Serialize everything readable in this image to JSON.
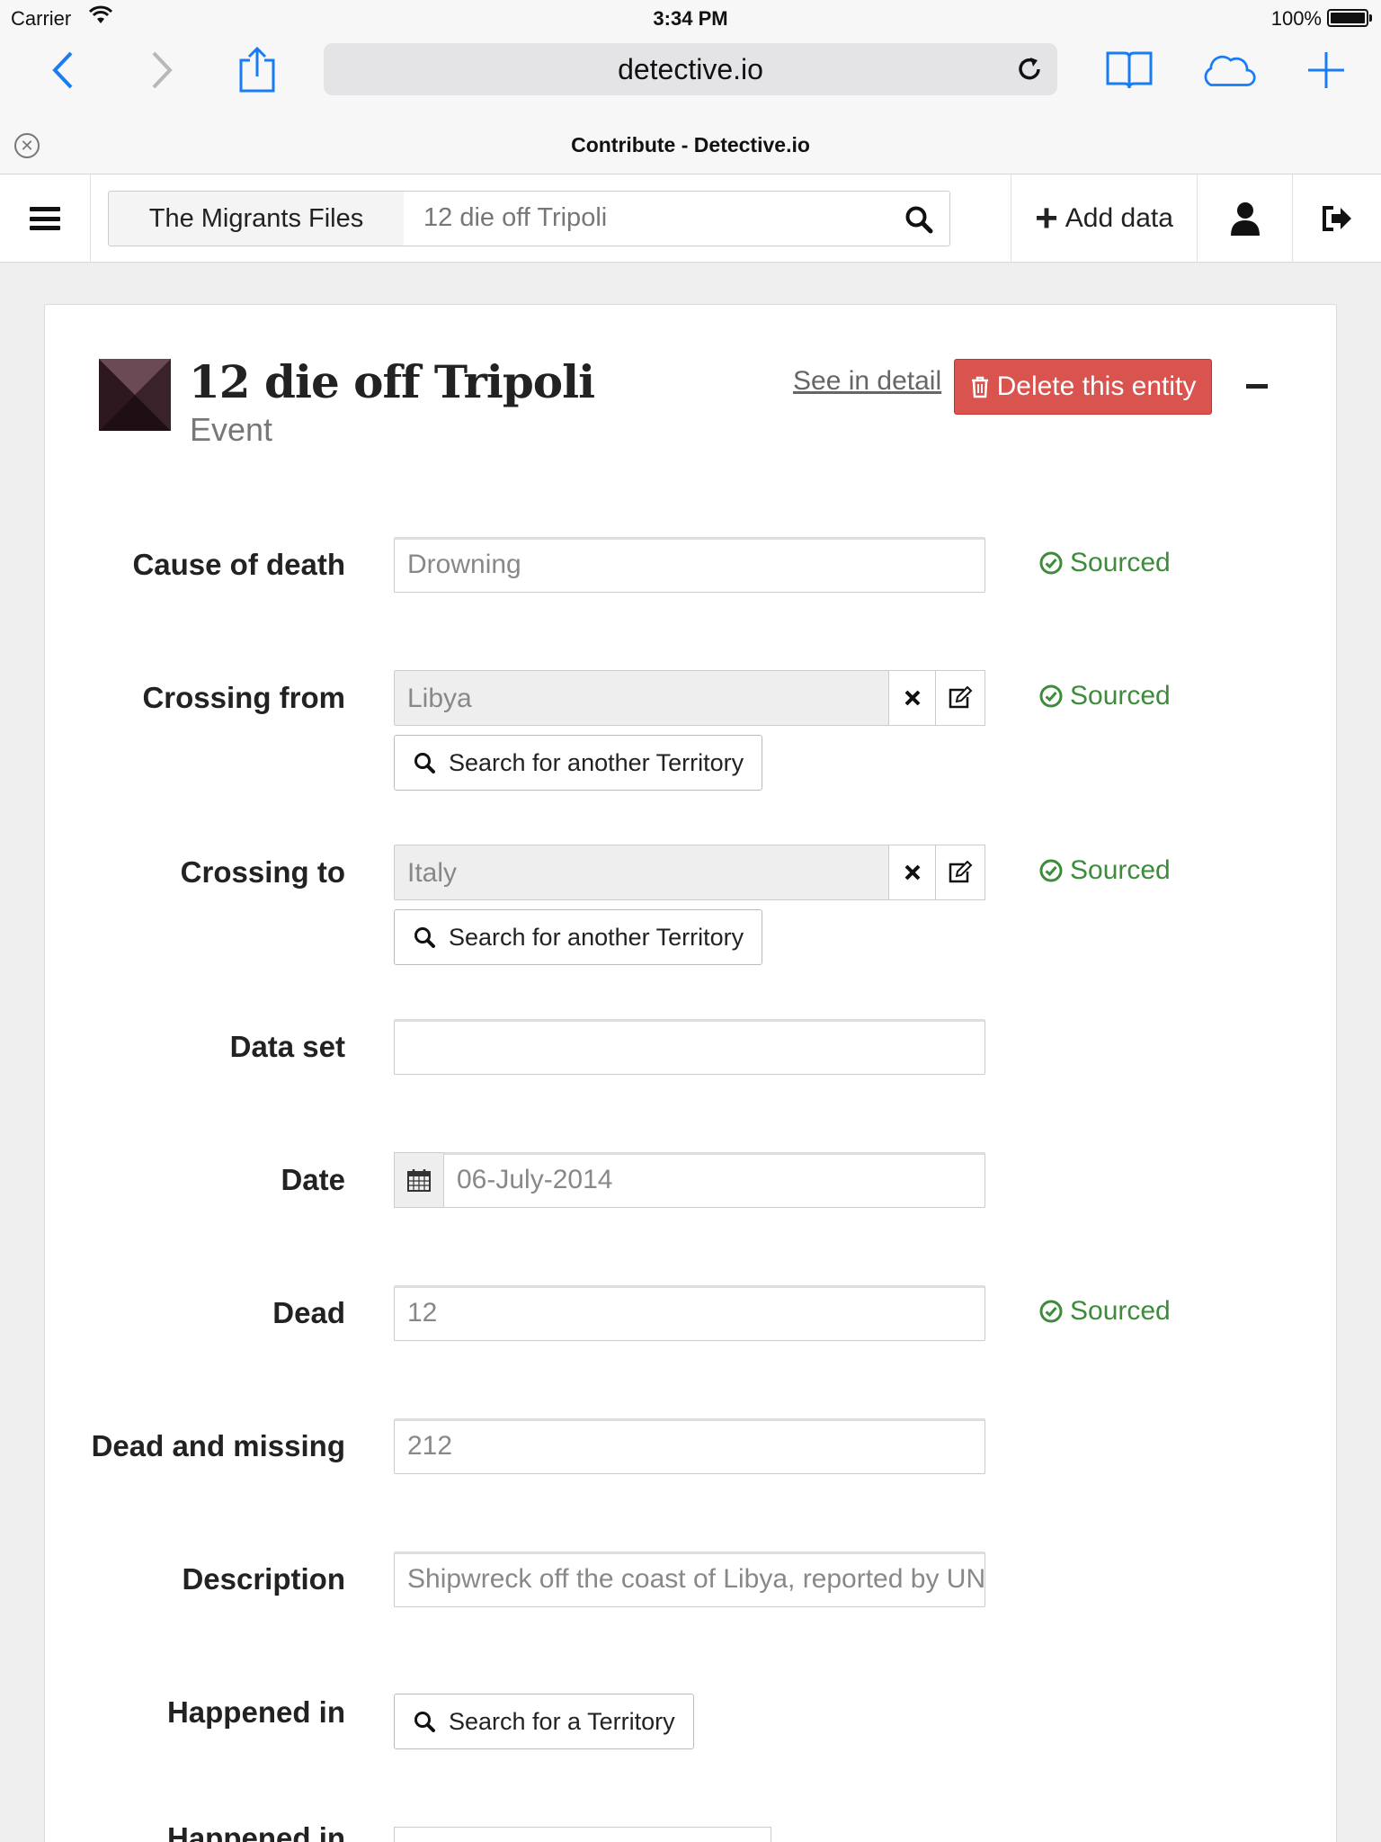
{
  "status_bar": {
    "carrier": "Carrier",
    "time": "3:34 PM",
    "battery": "100%"
  },
  "browser": {
    "url": "detective.io",
    "tab_title": "Contribute - Detective.io"
  },
  "navbar": {
    "project": "The Migrants Files",
    "search_value": "12 die off Tripoli",
    "add_label": "Add data"
  },
  "entity": {
    "title": "12 die off Tripoli",
    "type": "Event",
    "see_detail": "See in detail",
    "delete_label": "Delete this entity"
  },
  "fields": {
    "cause_of_death": {
      "label": "Cause of death",
      "value": "Drowning",
      "status": "Sourced"
    },
    "crossing_from": {
      "label": "Crossing from",
      "value": "Libya",
      "status": "Sourced",
      "search": "Search for another Territory"
    },
    "crossing_to": {
      "label": "Crossing to",
      "value": "Italy",
      "status": "Sourced",
      "search": "Search for another Territory"
    },
    "data_set": {
      "label": "Data set",
      "value": ""
    },
    "date": {
      "label": "Date",
      "value": "06-July-2014"
    },
    "dead": {
      "label": "Dead",
      "value": "12",
      "status": "Sourced"
    },
    "dead_and_missing": {
      "label": "Dead and missing",
      "value": "212"
    },
    "description": {
      "label": "Description",
      "value": "Shipwreck off the coast of Libya, reported by UNH"
    },
    "happened_in": {
      "label": "Happened in",
      "search": "Search for a Territory"
    },
    "next_partial": {
      "label": "Happened in"
    }
  },
  "colors": {
    "danger": "#d9534f",
    "sourced": "#3c8c3c",
    "ios_blue": "#1a7cf5"
  },
  "icons": [
    "back-icon",
    "forward-icon",
    "share-icon",
    "reload-icon",
    "bookmarks-icon",
    "cloud-icon",
    "new-tab-icon",
    "close-tab-icon",
    "menu-icon",
    "search-icon",
    "plus-icon",
    "user-icon",
    "sign-out-icon",
    "trash-icon",
    "minus-icon",
    "check-circle-icon",
    "times-icon",
    "edit-icon",
    "calendar-icon"
  ]
}
